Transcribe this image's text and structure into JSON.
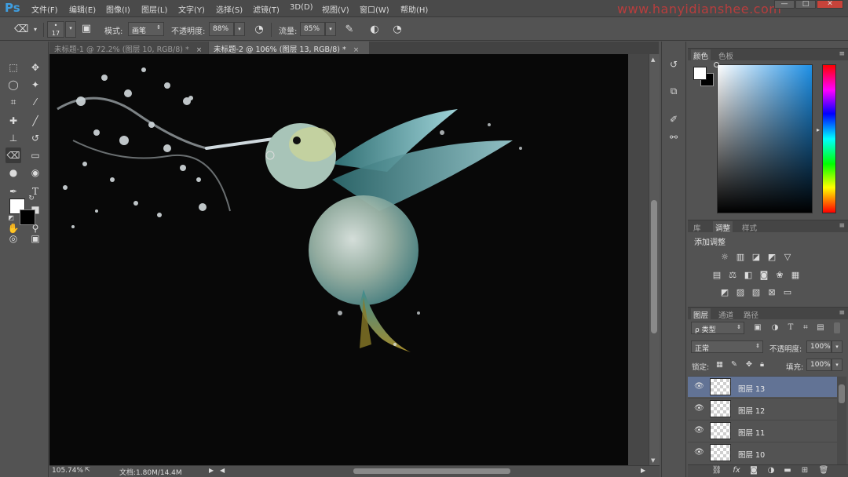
{
  "app": {
    "logo": "Ps",
    "watermark": "www.hanyidianshee.com"
  },
  "menu": [
    "文件(F)",
    "编辑(E)",
    "图像(I)",
    "图层(L)",
    "文字(Y)",
    "选择(S)",
    "滤镜(T)",
    "3D(D)",
    "视图(V)",
    "窗口(W)",
    "帮助(H)"
  ],
  "window_controls": {
    "minimize": "—",
    "restore": "□",
    "close": "✕"
  },
  "options": {
    "brush_size": "17",
    "mode_label": "模式:",
    "mode_value": "画笔",
    "opacity_label": "不透明度:",
    "opacity_value": "88%",
    "flow_label": "流量:",
    "flow_value": "85%"
  },
  "tabs": [
    {
      "label": "未标题-1 @ 72.2% (图层 10, RGB/8) *",
      "close": "×"
    },
    {
      "label": "未标题-2 @ 106% (图层 13, RGB/8) *",
      "close": "×"
    }
  ],
  "status": {
    "zoom": "105.74%",
    "doc": "文档:1.80M/14.4M"
  },
  "color_panel": {
    "tabs": [
      "颜色",
      "色板"
    ],
    "fg": "#ffffff",
    "bg": "#000000",
    "field_hue": "#1e90e6"
  },
  "adjust_panel": {
    "tabs": [
      "库",
      "调整",
      "样式"
    ],
    "title": "添加调整"
  },
  "layers_panel": {
    "tabs": [
      "图层",
      "通道",
      "路径"
    ],
    "filter_label": "ρ 类型",
    "blend_mode": "正常",
    "opacity_label": "不透明度:",
    "opacity_value": "100%",
    "lock_label": "锁定:",
    "fill_label": "填充:",
    "fill_value": "100%",
    "layers": [
      {
        "name": "图层 13",
        "selected": true
      },
      {
        "name": "图层 12",
        "selected": false
      },
      {
        "name": "图层 11",
        "selected": false
      },
      {
        "name": "图层 10",
        "selected": false
      }
    ]
  },
  "colors": {
    "accent_selected": "#627395",
    "panel_bg": "#535353",
    "canvas_bg": "#080808"
  }
}
